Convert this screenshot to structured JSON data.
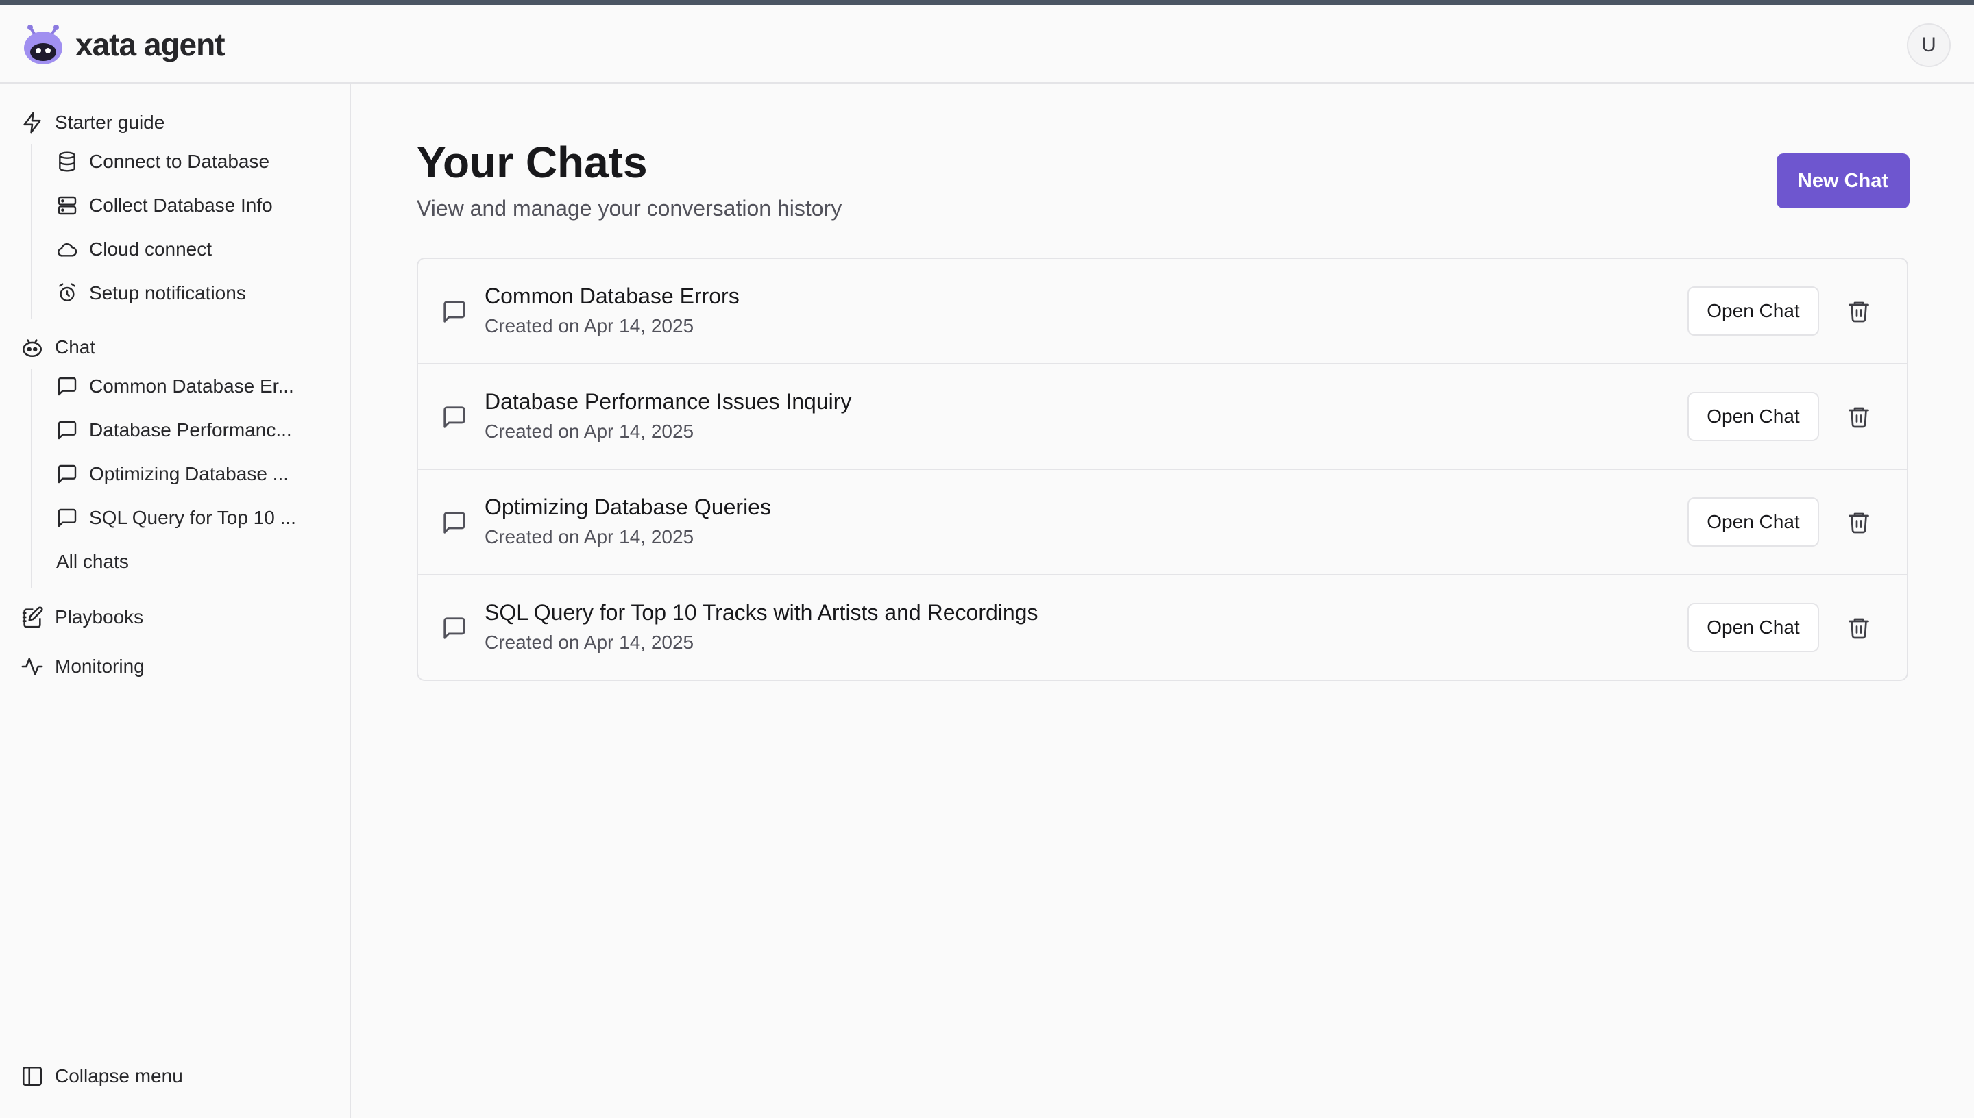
{
  "brand": {
    "name": "xata agent",
    "accent": "#6e56cf"
  },
  "user": {
    "initial": "U"
  },
  "sidebar": {
    "starter_guide": {
      "label": "Starter guide",
      "icon": "lightning-icon",
      "items": [
        {
          "label": "Connect to Database",
          "icon": "database-icon"
        },
        {
          "label": "Collect Database Info",
          "icon": "server-icon"
        },
        {
          "label": "Cloud connect",
          "icon": "cloud-icon"
        },
        {
          "label": "Setup notifications",
          "icon": "alarm-clock-icon"
        }
      ]
    },
    "chat": {
      "label": "Chat",
      "icon": "bot-icon",
      "items": [
        {
          "label": "Common Database Er...",
          "icon": "message-square-icon"
        },
        {
          "label": "Database Performanc...",
          "icon": "message-square-icon"
        },
        {
          "label": "Optimizing Database ...",
          "icon": "message-square-icon"
        },
        {
          "label": "SQL Query for Top 10 ...",
          "icon": "message-square-icon"
        }
      ],
      "all_chats": "All chats"
    },
    "playbooks": {
      "label": "Playbooks",
      "icon": "notebook-pen-icon"
    },
    "monitoring": {
      "label": "Monitoring",
      "icon": "activity-icon"
    },
    "collapse": {
      "label": "Collapse menu",
      "icon": "panel-left-icon"
    }
  },
  "main": {
    "title": "Your Chats",
    "subtitle": "View and manage your conversation history",
    "new_chat_label": "New Chat",
    "chats": [
      {
        "title": "Common Database Errors",
        "date": "Created on Apr 14, 2025",
        "open_label": "Open Chat"
      },
      {
        "title": "Database Performance Issues Inquiry",
        "date": "Created on Apr 14, 2025",
        "open_label": "Open Chat"
      },
      {
        "title": "Optimizing Database Queries",
        "date": "Created on Apr 14, 2025",
        "open_label": "Open Chat"
      },
      {
        "title": "SQL Query for Top 10 Tracks with Artists and Recordings",
        "date": "Created on Apr 14, 2025",
        "open_label": "Open Chat"
      }
    ]
  }
}
